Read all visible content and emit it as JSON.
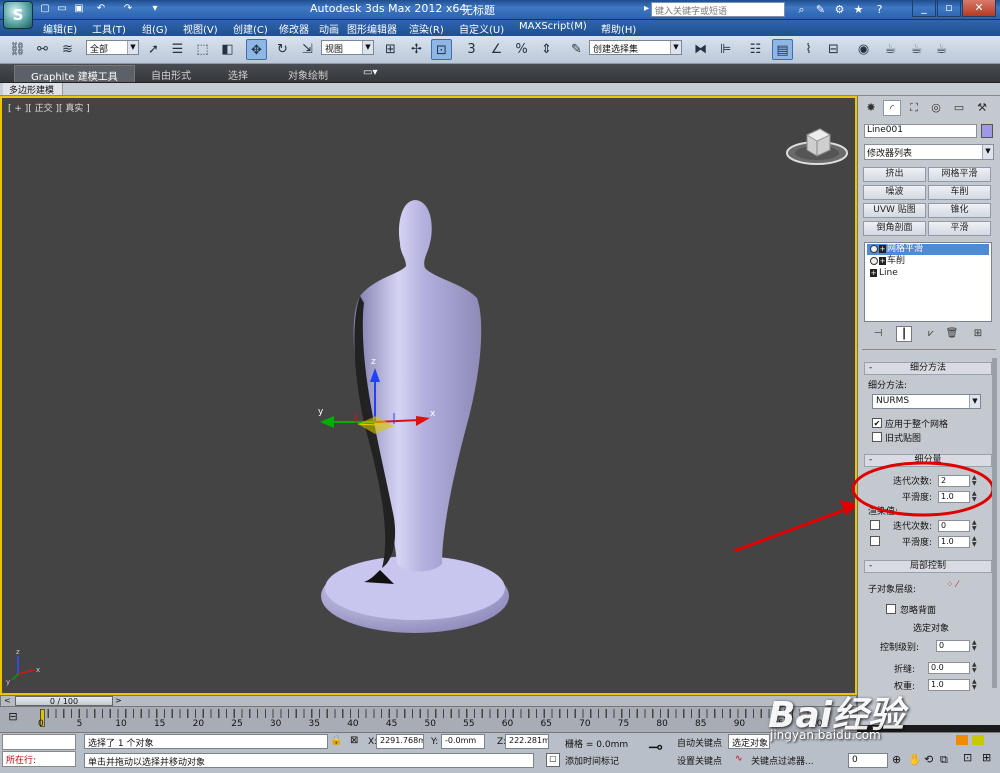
{
  "titlebar": {
    "app_title": "Autodesk 3ds Max  2012 x64",
    "doc_title": "无标题",
    "search_placeholder": "键入关键字或短语",
    "logo_text": "S"
  },
  "menu": {
    "items": [
      "编辑(E)",
      "工具(T)",
      "组(G)",
      "视图(V)",
      "创建(C)",
      "修改器",
      "动画",
      "图形编辑器",
      "渲染(R)",
      "自定义(U)",
      "MAXScript(M)",
      "帮助(H)"
    ]
  },
  "toolbar": {
    "selection_filter": "全部",
    "ref_coord": "视图",
    "named_selection": "创建选择集"
  },
  "ribbon": {
    "tabs": [
      "Graphite 建模工具",
      "自由形式",
      "选择",
      "对象绘制"
    ],
    "panel_label": "多边形建模"
  },
  "viewport": {
    "label": "[ + ][ 正交 ][ 真实 ]",
    "axis_x": "x",
    "axis_y": "y",
    "axis_z": "z"
  },
  "command_panel": {
    "object_name": "Line001",
    "modifier_list": "修改器列表",
    "modifier_buttons": [
      "挤出",
      "网格平滑",
      "噪波",
      "车削",
      "UVW 贴图",
      "锥化",
      "倒角剖面",
      "平滑"
    ],
    "stack": [
      "网格平滑",
      "车削",
      "Line"
    ],
    "rollout_subdivision_method": {
      "title": "细分方法",
      "method_label": "细分方法:",
      "method_value": "NURMS",
      "apply_whole_mesh": "应用于整个网格",
      "legacy_mapping": "旧式贴图"
    },
    "rollout_subdivision_amount": {
      "title": "细分量",
      "iterations_label": "迭代次数:",
      "iterations_value": "2",
      "smoothness_label": "平滑度:",
      "smoothness_value": "1.0",
      "render_values_label": "渲染值:",
      "render_iterations_label": "迭代次数:",
      "render_iterations_value": "0",
      "render_smoothness_label": "平滑度:",
      "render_smoothness_value": "1.0"
    },
    "rollout_local_control": {
      "title": "局部控制",
      "sublevel_label": "子对象层级:",
      "ignore_backfacing": "忽略背面",
      "selected_object": "选定对象",
      "control_level_label": "控制级别:",
      "control_level_value": "0",
      "crease_label": "折缝:",
      "crease_value": "0.0",
      "weight_label": "权重:",
      "weight_value": "1.0"
    }
  },
  "timeline": {
    "frame_display": "0 / 100",
    "ticks": [
      "0",
      "5",
      "10",
      "15",
      "20",
      "25",
      "30",
      "35",
      "40",
      "45",
      "50",
      "55",
      "60",
      "65",
      "70",
      "75",
      "80",
      "85",
      "90",
      "95",
      "100"
    ]
  },
  "status": {
    "script_listener": "所在行:",
    "selection_info": "选择了 1 个对象",
    "prompt": "单击并拖动以选择并移动对象",
    "x_label": "X:",
    "x_value": "2291.768m",
    "y_label": "Y:",
    "y_value": "-0.0mm",
    "z_label": "Z:",
    "z_value": "222.281mr",
    "grid_label": "栅格 = 0.0mm",
    "add_time_tag": "添加时间标记",
    "auto_key": "自动关键点",
    "set_key": "设置关键点",
    "selected_dropdown": "选定对象",
    "key_filters": "关键点过滤器...",
    "current_frame": "0"
  },
  "watermark": {
    "brand": "Bai经验",
    "url": "jingyan.baidu.com"
  },
  "colors": {
    "viewport_bg": "#444444",
    "viewport_border": "#e8c700",
    "object_color": "#9e98e6",
    "annotation_red": "#e00000",
    "stack_selected": "#4f8ad6"
  }
}
